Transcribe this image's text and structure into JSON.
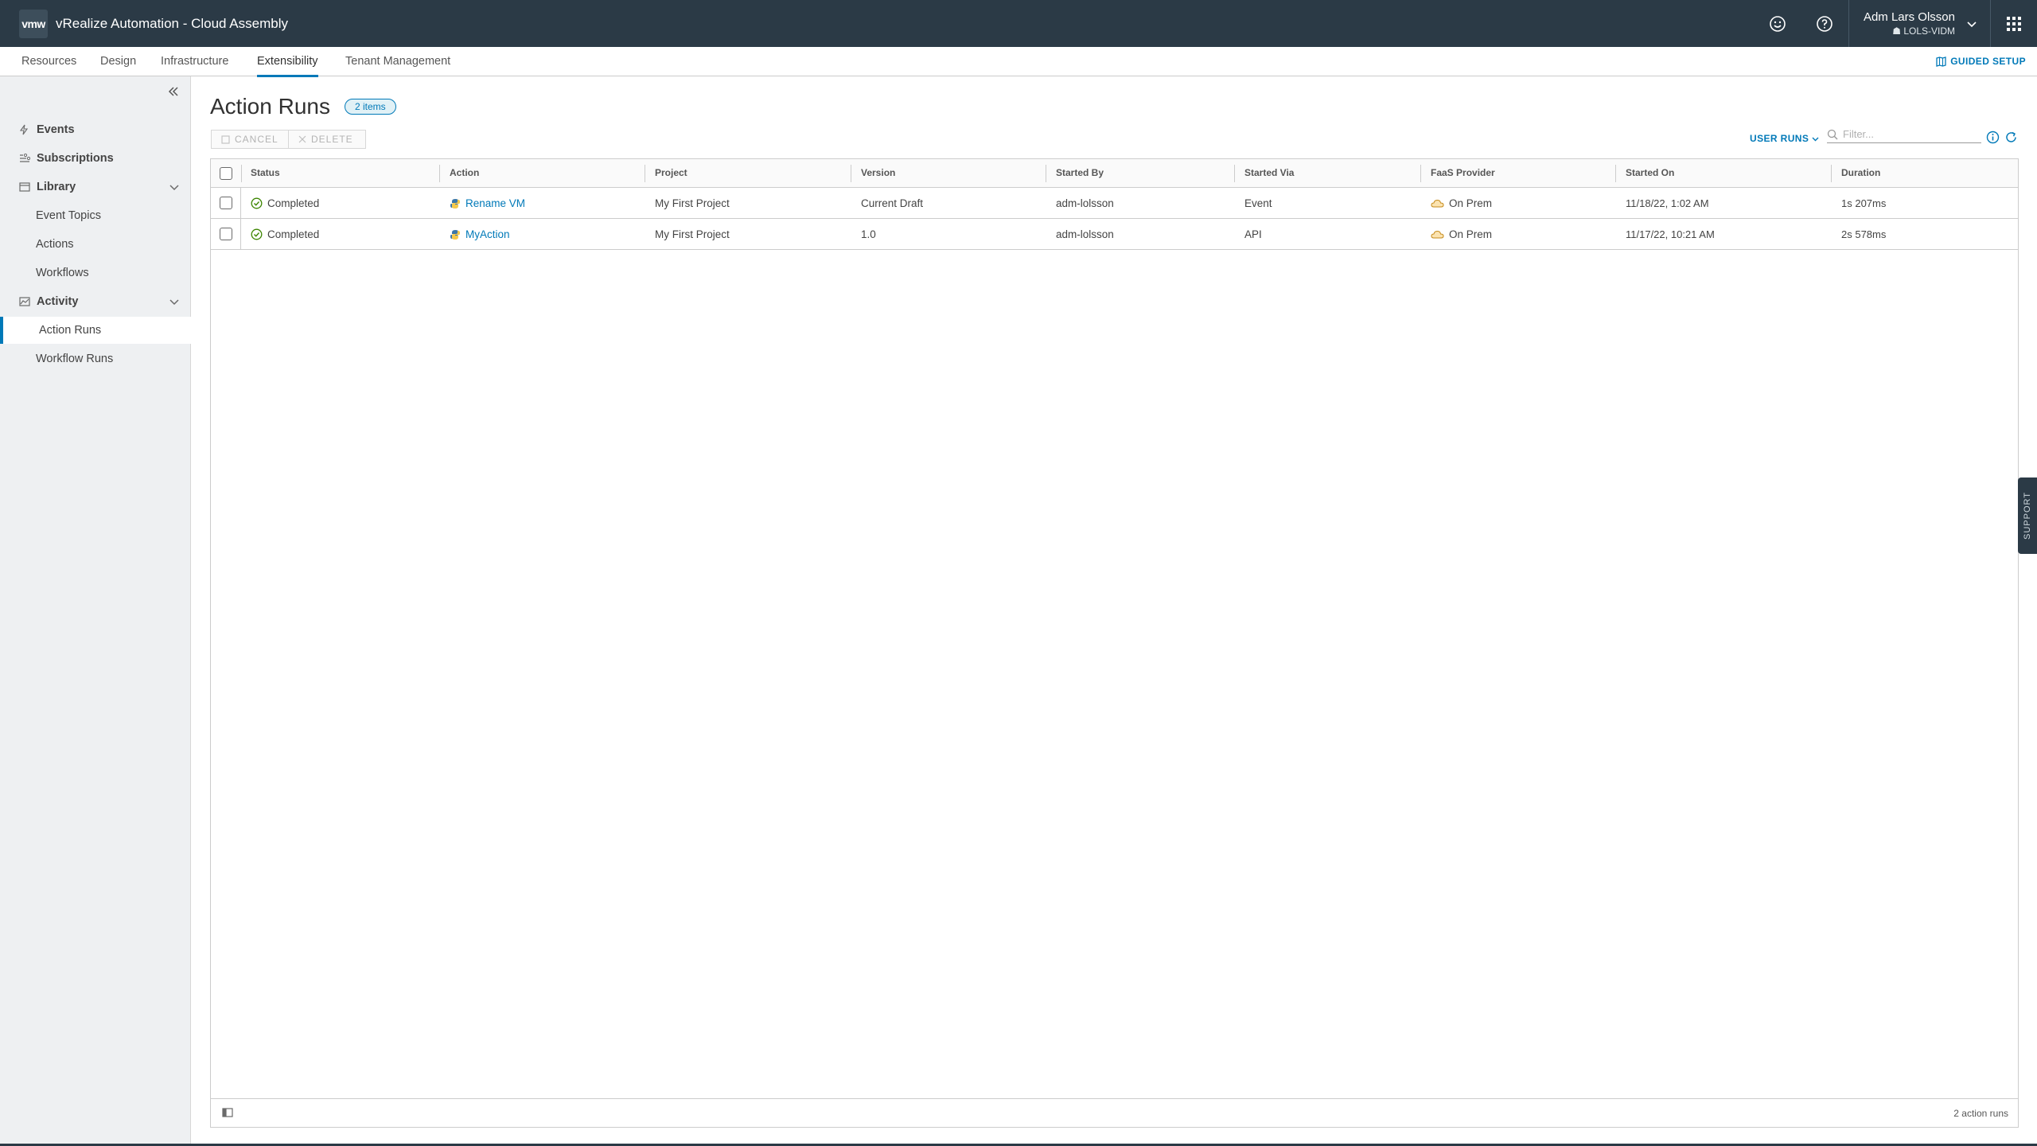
{
  "header": {
    "logo": "vmw",
    "title": "vRealize Automation - Cloud Assembly",
    "user_name": "Adm Lars Olsson",
    "tenant": "LOLS-VIDM"
  },
  "topnav": {
    "tabs": [
      "Resources",
      "Design",
      "Infrastructure",
      "Extensibility",
      "Tenant Management"
    ],
    "active": "Extensibility",
    "guided_setup": "GUIDED SETUP"
  },
  "sidebar": {
    "items": [
      {
        "label": "Events",
        "icon": "lightning-icon"
      },
      {
        "label": "Subscriptions",
        "icon": "subscriptions-icon"
      },
      {
        "label": "Library",
        "icon": "library-icon"
      },
      {
        "label": "Event Topics"
      },
      {
        "label": "Actions"
      },
      {
        "label": "Workflows"
      },
      {
        "label": "Activity",
        "icon": "activity-icon"
      },
      {
        "label": "Action Runs"
      },
      {
        "label": "Workflow Runs"
      }
    ],
    "selected": "Action Runs"
  },
  "main": {
    "title": "Action Runs",
    "badge": "2 items",
    "cancel_label": "CANCEL",
    "delete_label": "DELETE",
    "user_runs_label": "USER RUNS",
    "filter_placeholder": "Filter..."
  },
  "grid": {
    "columns": [
      "Status",
      "Action",
      "Project",
      "Version",
      "Started By",
      "Started Via",
      "FaaS Provider",
      "Started On",
      "Duration"
    ],
    "rows": [
      {
        "status": "Completed",
        "action": "Rename VM",
        "project": "My First Project",
        "version": "Current Draft",
        "started_by": "adm-lolsson",
        "started_via": "Event",
        "faas_provider": "On Prem",
        "started_on": "11/18/22, 1:02 AM",
        "duration": "1s 207ms"
      },
      {
        "status": "Completed",
        "action": "MyAction",
        "project": "My First Project",
        "version": "1.0",
        "started_by": "adm-lolsson",
        "started_via": "API",
        "faas_provider": "On Prem",
        "started_on": "11/17/22, 10:21 AM",
        "duration": "2s 578ms"
      }
    ],
    "footer_count": "2 action runs"
  },
  "support_label": "SUPPORT",
  "colors": {
    "header_bg": "#2b3a46",
    "accent": "#0079b8",
    "success": "#3c8500",
    "sidebar_bg": "#eef0f2"
  }
}
